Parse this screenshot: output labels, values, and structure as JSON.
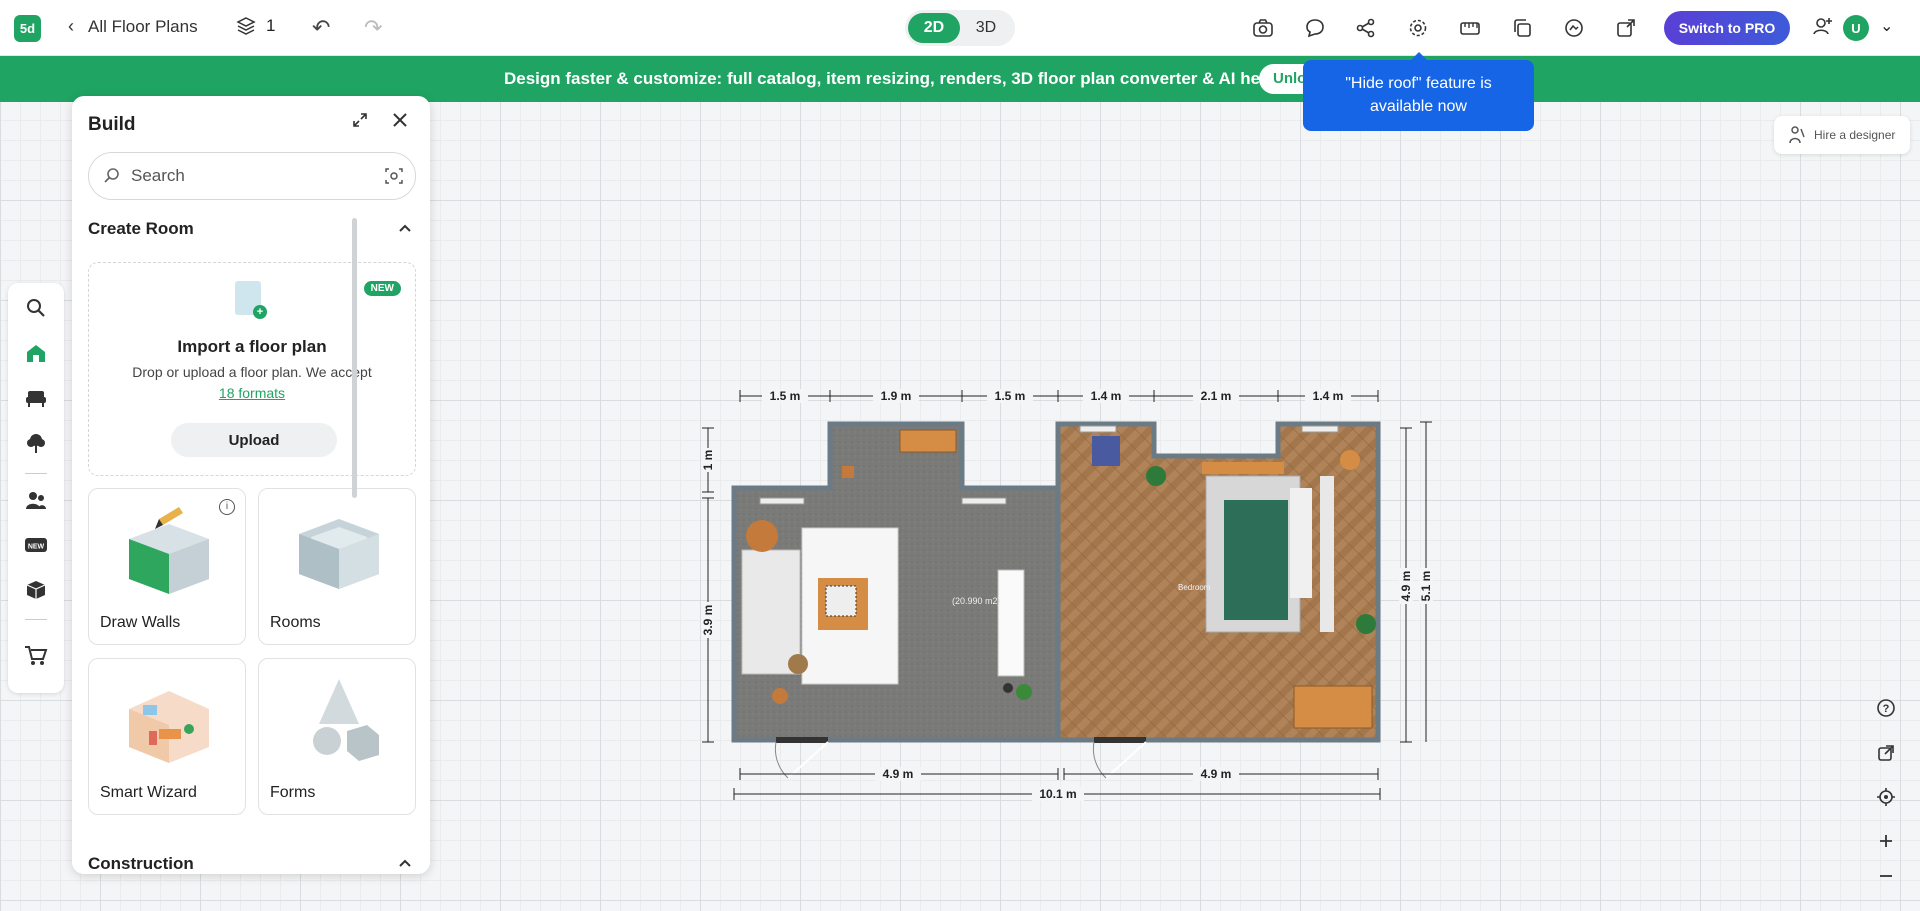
{
  "topbar": {
    "logo": "5d",
    "back_label": "All Floor Plans",
    "floors_count": "1",
    "mode_2d": "2D",
    "mode_3d": "3D",
    "pro_label": "Switch to PRO",
    "avatar_initial": "U"
  },
  "banner": {
    "text": "Design faster & customize: full catalog, item resizing, renders, 3D floor plan converter & AI help",
    "unlock_label": "Unlock"
  },
  "tooltip": {
    "text": "\"Hide roof\" feature is available now"
  },
  "panel": {
    "title": "Build",
    "search_placeholder": "Search",
    "create_room_title": "Create Room",
    "import_badge": "NEW",
    "import_title": "Import a floor plan",
    "import_desc": "Drop or upload a floor plan. We accept",
    "import_link": "18 formats",
    "upload_label": "Upload",
    "cards": [
      {
        "label": "Draw Walls"
      },
      {
        "label": "Rooms"
      },
      {
        "label": "Smart Wizard"
      },
      {
        "label": "Forms"
      }
    ],
    "construction_title": "Construction"
  },
  "hire_label": "Hire a designer",
  "plan": {
    "top_dims": [
      "1.5 m",
      "1.9 m",
      "1.5 m",
      "1.4 m",
      "2.1 m",
      "1.4 m"
    ],
    "bottom_dims": [
      "4.9 m",
      "4.9 m"
    ],
    "total_width": "10.1 m",
    "left_dims": [
      "1 m",
      "3.9 m"
    ],
    "right_dims": [
      "4.9 m",
      "5.1 m"
    ],
    "living_area": "(20.990 m2)",
    "bedroom_label": "Bedroom"
  },
  "colors": {
    "brand_green": "#1fa463",
    "tooltip_blue": "#1565e6",
    "floor_gray": "#7a7a78",
    "parquet": "#b08358",
    "wall": "#6b7b86"
  }
}
